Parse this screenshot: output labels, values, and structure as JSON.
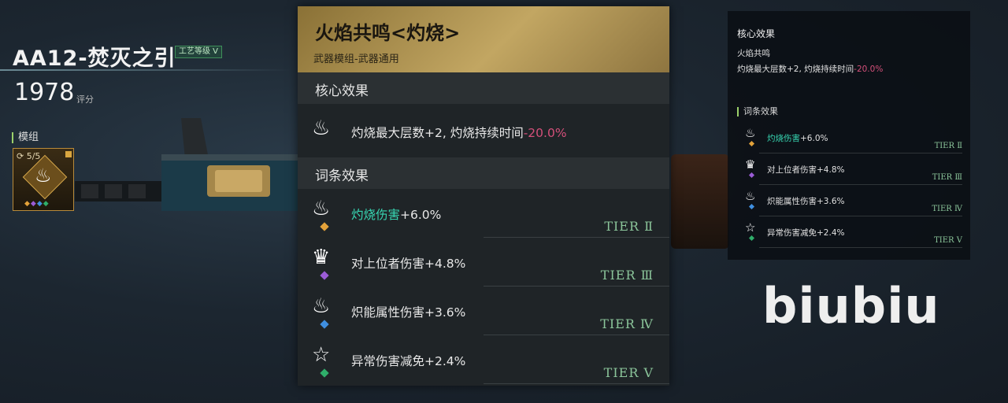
{
  "weapon": {
    "name": "AA12-焚灭之引",
    "craft_badge": "工艺等级 Ⅴ",
    "score": "1978",
    "score_label": "评分"
  },
  "module": {
    "label": "模组",
    "count": "5/5"
  },
  "panel": {
    "title": "火焰共鸣<灼烧>",
    "subtitle": "武器模组-武器通用",
    "core_header": "核心效果",
    "core_text": "灼烧最大层数+2, 灼烧持续时间",
    "core_value": "-20.0%",
    "affix_header": "词条效果",
    "affixes": [
      {
        "name": "灼烧伤害",
        "value": "+6.0%",
        "tier": "TIER Ⅱ",
        "color": "#e3a23a",
        "highlight": true,
        "icon": "fire-claw-icon"
      },
      {
        "name": "对上位者伤害",
        "value": "+4.8%",
        "tier": "TIER Ⅲ",
        "color": "#9b5cd6",
        "highlight": false,
        "icon": "crown-skull-icon"
      },
      {
        "name": "炽能属性伤害",
        "value": "+3.6%",
        "tier": "TIER Ⅳ",
        "color": "#3f8fe0",
        "highlight": false,
        "icon": "flame-up-icon"
      },
      {
        "name": "异常伤害减免",
        "value": "+2.4%",
        "tier": "TIER Ⅴ",
        "color": "#2fae6a",
        "highlight": false,
        "icon": "star-shield-icon"
      }
    ]
  },
  "summary": {
    "core_header": "核心效果",
    "core_name": "火焰共鸣",
    "core_text": "灼烧最大层数+2, 灼烧持续时间",
    "core_value": "-20.0%",
    "affix_header": "词条效果"
  },
  "watermark": "biubiu"
}
